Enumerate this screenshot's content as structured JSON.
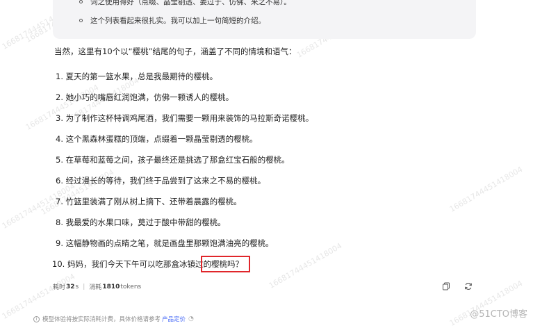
{
  "previous_card": {
    "items": [
      "词之使用得好（点缀、晶莹剔透、姜过于、仿佛、来之不易）。",
      "这个列表看起来很扎实。我可以加上一句简短的介绍。"
    ]
  },
  "response": {
    "intro": "当然，这里有10个以“樱桃”结尾的句子，涵盖了不同的情境和语气：",
    "sentences": [
      {
        "num": "1.",
        "text": "夏天的第一篮水果，总是我最期待的樱桃。"
      },
      {
        "num": "2.",
        "text": "她小巧的嘴唇红润饱满，仿佛一颗诱人的樱桃。"
      },
      {
        "num": "3.",
        "text": "为了制作这杯特调鸡尾酒，我们需要一颗用来装饰的马拉斯奇诺樱桃。"
      },
      {
        "num": "4.",
        "text": "这个黑森林蛋糕的顶端，点缀着一颗晶莹剔透的樱桃。"
      },
      {
        "num": "5.",
        "text": "在草莓和蓝莓之间，孩子最终还是挑选了那盒红宝石般的樱桃。"
      },
      {
        "num": "6.",
        "text": "经过漫长的等待，我们终于品尝到了这来之不易的樱桃。"
      },
      {
        "num": "7.",
        "text": "竹篮里装满了刚从树上摘下、还带着晨露的樱桃。"
      },
      {
        "num": "8.",
        "text": "我最爱的水果口味，莫过于酸中带甜的樱桃。"
      },
      {
        "num": "9.",
        "text": "这幅静物画的点睛之笔，就是画盘里那颗饱满油亮的樱桃。"
      },
      {
        "num": "10.",
        "text": "妈妈，我们今天下午可以吃那盒冰镇过的樱桃吗？"
      }
    ]
  },
  "meta": {
    "time_label": "耗时",
    "time_value": "32",
    "time_unit": "s",
    "tokens_label": "消耗",
    "tokens_value": "1810",
    "tokens_unit": "tokens",
    "copy_icon": "copy-icon",
    "regenerate_icon": "refresh-icon"
  },
  "footer": {
    "notice": "模型体验将按实际消耗计费，具体价格请参考",
    "link": "产品定价"
  },
  "watermark": {
    "text": "16681744451418004",
    "brand": "@51CTO博客"
  },
  "colors": {
    "highlight_border": "#e0262b",
    "card_bg": "#f4f4f6",
    "link": "#4a6cf7"
  }
}
